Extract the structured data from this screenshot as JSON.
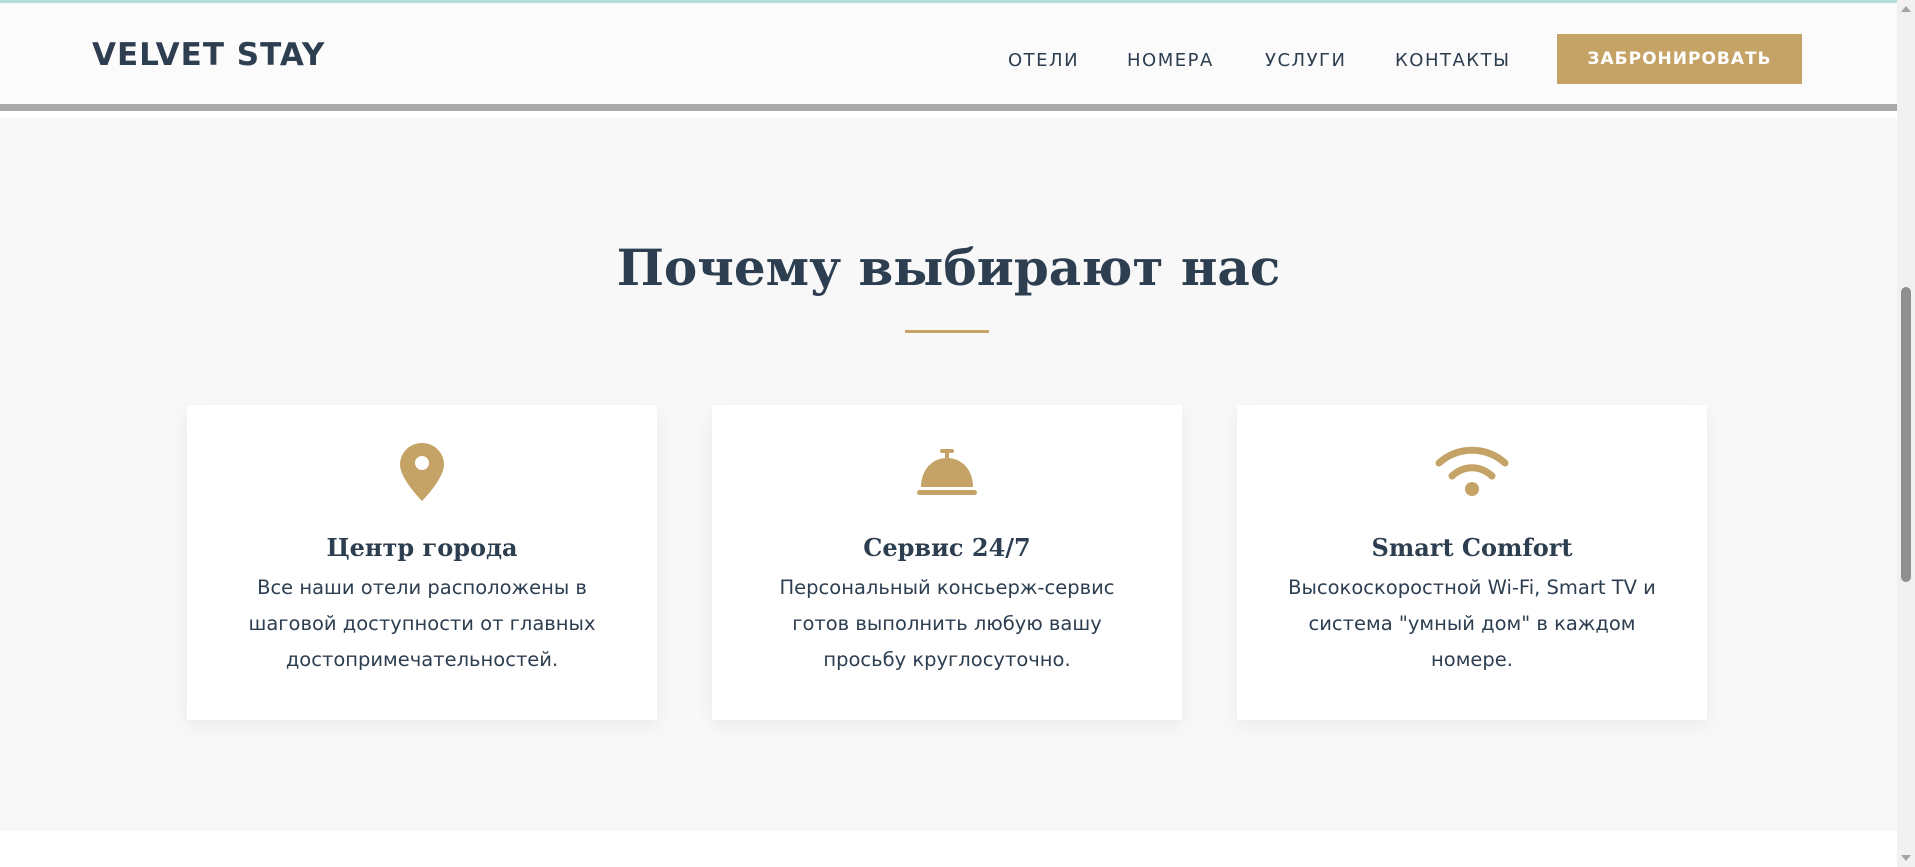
{
  "header": {
    "logo": "VELVET STAY",
    "nav": [
      "ОТЕЛИ",
      "НОМЕРА",
      "УСЛУГИ",
      "КОНТАКТЫ"
    ],
    "book_label": "ЗАБРОНИРОВАТЬ"
  },
  "features": {
    "title": "Почему выбирают нас",
    "cards": [
      {
        "icon": "map-pin-icon",
        "title": "Центр города",
        "text": "Все наши отели расположены в шаговой доступности от главных достопримечательностей."
      },
      {
        "icon": "concierge-bell-icon",
        "title": "Сервис 24/7",
        "text": "Персональный консьерж-сервис готов выполнить любую вашу просьбу круглосуточно."
      },
      {
        "icon": "wifi-icon",
        "title": "Smart Comfort",
        "text": "Высокоскоростной Wi-Fi, Smart TV и система \"умный дом\" в каждом номере."
      }
    ]
  },
  "colors": {
    "accent": "#c5a266",
    "text": "#2c3e50",
    "section_bg": "#f8f8f8"
  }
}
